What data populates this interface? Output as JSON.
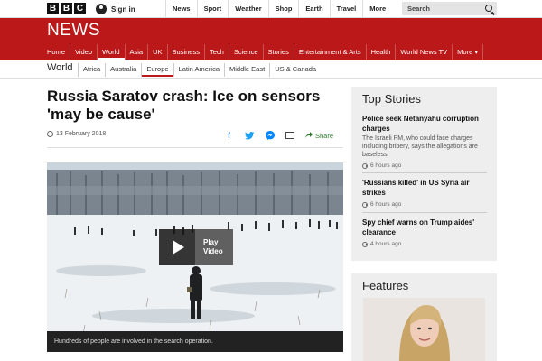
{
  "brand": {
    "bbc_letters": [
      "B",
      "B",
      "C"
    ],
    "news_logo": "NEWS"
  },
  "topbar": {
    "signin": "Sign in",
    "nav": [
      "News",
      "Sport",
      "Weather",
      "Shop",
      "Earth",
      "Travel"
    ],
    "more": "More",
    "more_arrow": "▾",
    "search_placeholder": "Search"
  },
  "rednav": [
    "Home",
    "Video",
    "World",
    "Asia",
    "UK",
    "Business",
    "Tech",
    "Science",
    "Stories",
    "Entertainment & Arts",
    "Health",
    "World News TV",
    "More ▾"
  ],
  "worldnav": {
    "title": "World",
    "items": [
      "Africa",
      "Australia",
      "Europe",
      "Latin America",
      "Middle East",
      "US & Canada"
    ]
  },
  "article": {
    "headline": "Russia Saratov crash: Ice on sensors 'may be cause'",
    "date": "13 February 2018",
    "share_label": "Share",
    "play_label": "Play Video",
    "caption": "Hundreds of people are involved in the search operation."
  },
  "top_stories": {
    "title": "Top Stories",
    "items": [
      {
        "headline": "Police seek Netanyahu corruption charges",
        "summary": "The Israeli PM, who could face charges including bribery, says the allegations are baseless.",
        "time": "6 hours ago"
      },
      {
        "headline": "'Russians killed' in US Syria air strikes",
        "summary": "",
        "time": "6 hours ago"
      },
      {
        "headline": "Spy chief warns on Trump aides' clearance",
        "summary": "",
        "time": "4 hours ago"
      }
    ]
  },
  "features": {
    "title": "Features"
  },
  "colors": {
    "brand_red": "#bb1919",
    "facebook": "#3b5998",
    "twitter": "#1da1f2",
    "messenger": "#0084ff",
    "share_green": "#2a7d2a"
  },
  "icons": [
    "user-icon",
    "search-icon",
    "clock-icon",
    "facebook-icon",
    "twitter-icon",
    "messenger-icon",
    "mail-icon",
    "share-icon",
    "play-icon"
  ]
}
